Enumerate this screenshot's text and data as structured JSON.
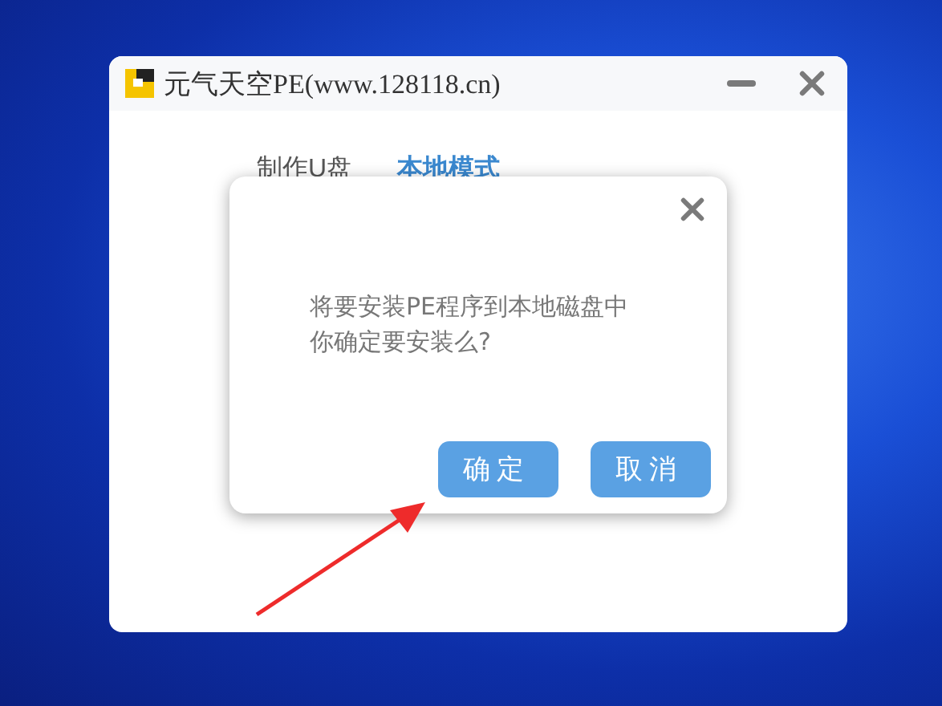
{
  "window": {
    "title": "元气天空PE(www.128118.cn)"
  },
  "tabs": [
    {
      "label": "制作U盘",
      "selected": false
    },
    {
      "label": "本地模式",
      "selected": true
    }
  ],
  "dialog": {
    "message_lines": [
      "将要安装PE程序到本地磁盘中",
      "你确定要安装么?"
    ],
    "buttons": [
      "确定",
      "取消"
    ]
  }
}
